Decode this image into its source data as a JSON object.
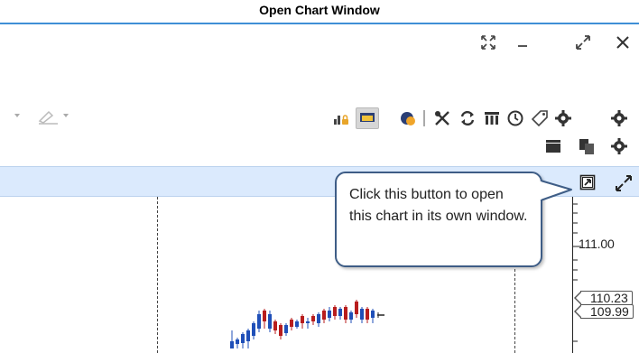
{
  "page": {
    "title": "Open Chart Window"
  },
  "window_controls": [
    {
      "name": "restore-layout-icon"
    },
    {
      "name": "minimize-icon"
    },
    {
      "name": "maximize-icon"
    },
    {
      "name": "close-icon"
    }
  ],
  "toolbar": {
    "row1_icons": [
      "order-lock-icon",
      "chat-panel-icon",
      "theme-icon",
      "tools-icon",
      "refresh-icon",
      "columns-icon",
      "history-icon",
      "tag-icon",
      "settings-icon"
    ],
    "row2_icons": [
      "layout-icon",
      "copy-icon",
      "settings-icon"
    ]
  },
  "chart_header": {
    "open_window_button": "open-chart-window-icon",
    "expand_button": "expand-icon"
  },
  "callout": {
    "text": "Click this button to open this chart in its own window."
  },
  "price_axis": {
    "label_111": "111.00",
    "tag_current": "110.23",
    "tag_bid": "109.99"
  },
  "colors": {
    "accent": "#3f8fd6",
    "strip": "#dbeafd",
    "callout_border": "#3e5d86",
    "candle_up": "#1f4fb8",
    "candle_down": "#b81d1d"
  }
}
